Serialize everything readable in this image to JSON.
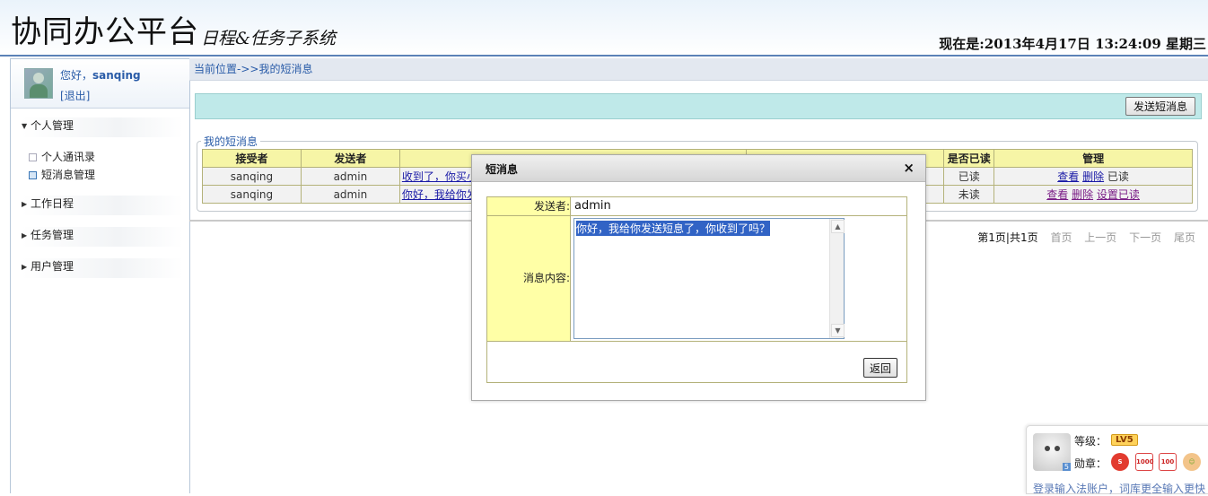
{
  "header": {
    "title": "协同办公平台",
    "subtitle": "日程&任务子系统",
    "clock": "现在是:2013年4月17日 13:24:09 星期三"
  },
  "sidebar": {
    "greeting_prefix": "您好，",
    "username": "sanqing",
    "logout": "[退出]",
    "groups": [
      {
        "label": "个人管理",
        "expanded": true
      },
      {
        "label": "工作日程",
        "expanded": false
      },
      {
        "label": "任务管理",
        "expanded": false
      },
      {
        "label": "用户管理",
        "expanded": false
      }
    ],
    "personal_items": [
      {
        "label": "个人通讯录",
        "active": false
      },
      {
        "label": "短消息管理",
        "active": true
      }
    ]
  },
  "main": {
    "breadcrumb": "当前位置->>我的短消息",
    "send_button": "发送短消息",
    "legend": "我的短消息",
    "columns": [
      "接受者",
      "发送者",
      "",
      "",
      "是否已读",
      "管理"
    ],
    "rows": [
      {
        "receiver": "sanqing",
        "sender": "admin",
        "content": "收到了，你买小",
        "read": "已读",
        "view": "查看",
        "delete": "删除",
        "extra": "已读",
        "extra_link": false
      },
      {
        "receiver": "sanqing",
        "sender": "admin",
        "content": "你好，我给你发",
        "read": "未读",
        "view": "查看",
        "delete": "删除",
        "extra": "设置已读",
        "extra_link": true
      }
    ],
    "pager": {
      "current": "第1页|共1页",
      "first": "首页",
      "prev": "上一页",
      "next": "下一页",
      "last": "尾页"
    }
  },
  "modal": {
    "title": "短消息",
    "close": "×",
    "sender_label": "发送者:",
    "sender_value": "admin",
    "content_label": "消息内容:",
    "content_value": "你好，我给你发送短息了，你收到了吗？",
    "return_button": "返回"
  },
  "ime": {
    "level_label": "等级：",
    "level_value": "LV5",
    "badge_label": "勋章：",
    "badges": [
      "S",
      "1000",
      "100",
      "☺"
    ],
    "avatar_number": "5",
    "tip": "登录输入法账户，词库更全输入更快"
  }
}
